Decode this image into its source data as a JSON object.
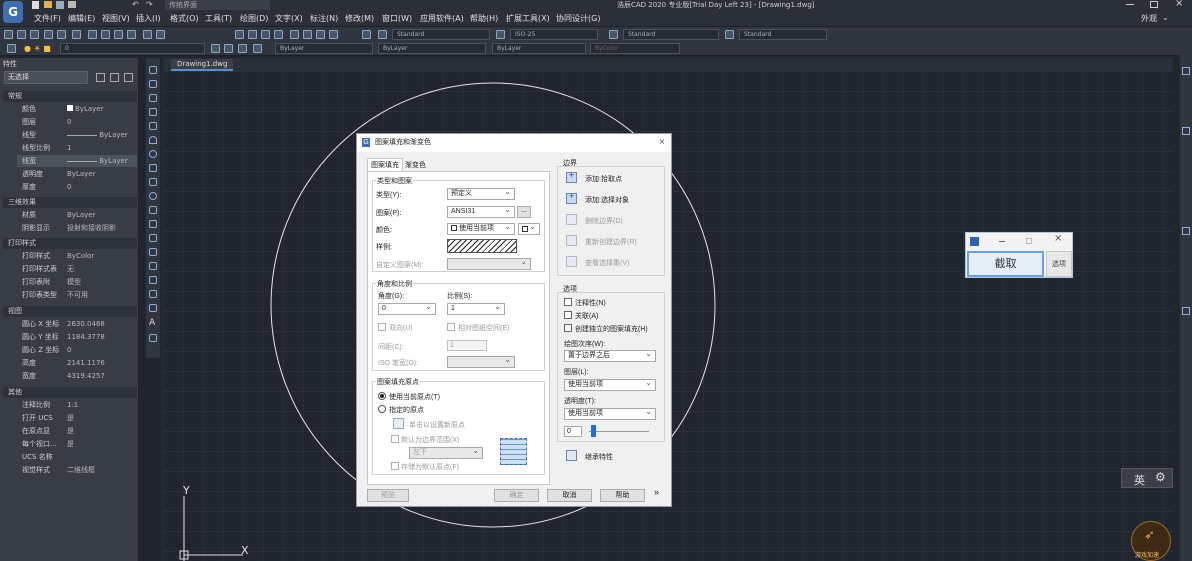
{
  "title": "浩辰CAD 2020 专业版[Trial Day Left 23] - [Drawing1.dwg]",
  "quick_access": {
    "workspace": "传统界面"
  },
  "menu": [
    "文件(F)",
    "编辑(E)",
    "视图(V)",
    "插入(I)",
    "格式(O)",
    "工具(T)",
    "绘图(D)",
    "文字(X)",
    "标注(N)",
    "修改(M)",
    "窗口(W)",
    "应用软件(A)",
    "帮助(H)",
    "扩展工具(X)",
    "协同设计(G)"
  ],
  "appearance": "外观",
  "toolbar1": {
    "textstyle": "Standard",
    "dimstyle": "ISO-25",
    "tablestyle": "Standard",
    "mleaderstyle": "Standard"
  },
  "toolbar2": {
    "layer": "0",
    "color": "ByLayer",
    "linetype": "ByLayer",
    "lineweight": "ByLayer",
    "plotstyle": "ByColor"
  },
  "properties": {
    "header": "特性",
    "selection": "无选择",
    "sections": [
      {
        "title": "常规",
        "rows": [
          {
            "k": "颜色",
            "v": "ByLayer"
          },
          {
            "k": "图层",
            "v": "0"
          },
          {
            "k": "线型",
            "v": "ByLayer"
          },
          {
            "k": "线型比例",
            "v": "1"
          },
          {
            "k": "线宽",
            "v": "ByLayer"
          },
          {
            "k": "透明度",
            "v": "ByLayer"
          },
          {
            "k": "厚度",
            "v": "0"
          }
        ]
      },
      {
        "title": "三维效果",
        "rows": [
          {
            "k": "材质",
            "v": "ByLayer"
          },
          {
            "k": "阴影显示",
            "v": "投射和接收阴影"
          }
        ]
      },
      {
        "title": "打印样式",
        "rows": [
          {
            "k": "打印样式",
            "v": "ByColor"
          },
          {
            "k": "打印样式表",
            "v": "无"
          },
          {
            "k": "打印表附",
            "v": "模型"
          },
          {
            "k": "打印表类型",
            "v": "不可用"
          }
        ]
      },
      {
        "title": "视图",
        "rows": [
          {
            "k": "圆心 X 坐标",
            "v": "2630.0468"
          },
          {
            "k": "圆心 Y 坐标",
            "v": "1184.3778"
          },
          {
            "k": "圆心 Z 坐标",
            "v": "0"
          },
          {
            "k": "高度",
            "v": "2141.1176"
          },
          {
            "k": "宽度",
            "v": "4319.4257"
          }
        ]
      },
      {
        "title": "其他",
        "rows": [
          {
            "k": "注释比例",
            "v": "1:1"
          },
          {
            "k": "打开 UCS",
            "v": "是"
          },
          {
            "k": "在原点显",
            "v": "是"
          },
          {
            "k": "每个视口...",
            "v": "是"
          },
          {
            "k": "UCS 名称",
            "v": ""
          },
          {
            "k": "视觉样式",
            "v": "二维线框"
          }
        ]
      }
    ]
  },
  "document_tab": "Drawing1.dwg",
  "ucs": {
    "x": "X",
    "y": "Y"
  },
  "dialog": {
    "title": "图案填充和渐变色",
    "tabs": [
      "图案填充",
      "渐变色"
    ],
    "type_group": "类型和图案",
    "type_label": "类型(Y):",
    "type_value": "预定义",
    "pattern_label": "图案(P):",
    "pattern_value": "ANSI31",
    "color_label": "颜色:",
    "color_value": "使用当前项",
    "sample_label": "样例:",
    "custom_label": "自定义图案(M):",
    "angle_group": "角度和比例",
    "angle_label": "角度(G):",
    "angle_value": "0",
    "scale_label": "比例(S):",
    "scale_value": "1",
    "double_label": "双向(U)",
    "relative_label": "相对图纸空间(E)",
    "spacing_label": "间距(C):",
    "spacing_value": "1",
    "iso_label": "ISO 笔宽(O):",
    "origin_group": "图案填充原点",
    "origin_current": "使用当前原点(T)",
    "origin_specified": "指定的原点",
    "origin_click": "单击以设置新原点",
    "origin_default": "默认为边界范围(X)",
    "origin_pos": "左下",
    "origin_store": "存储为默认原点(F)",
    "boundary_group": "边界",
    "add_pick": "添加:拾取点",
    "add_select": "添加:选择对象",
    "remove_boundary": "删除边界(D)",
    "recreate_boundary": "重新创建边界(R)",
    "view_selection": "查看选择集(V)",
    "options_group": "选项",
    "annotative": "注释性(N)",
    "associative": "关联(A)",
    "separate": "创建独立的图案填充(H)",
    "draw_order_label": "绘图次序(W):",
    "draw_order_value": "置于边界之后",
    "layer_label": "图层(L):",
    "layer_value": "使用当前项",
    "transparency_label": "透明度(T):",
    "transparency_value": "使用当前项",
    "transparency_num": "0",
    "inherit": "继承特性",
    "preview": "预览",
    "ok": "确定",
    "cancel": "取消",
    "help": "帮助",
    "more": "»"
  },
  "capture": {
    "button": "截取",
    "options": "选项"
  },
  "ime": {
    "lang": "英"
  },
  "game_badge": "游戏加速"
}
